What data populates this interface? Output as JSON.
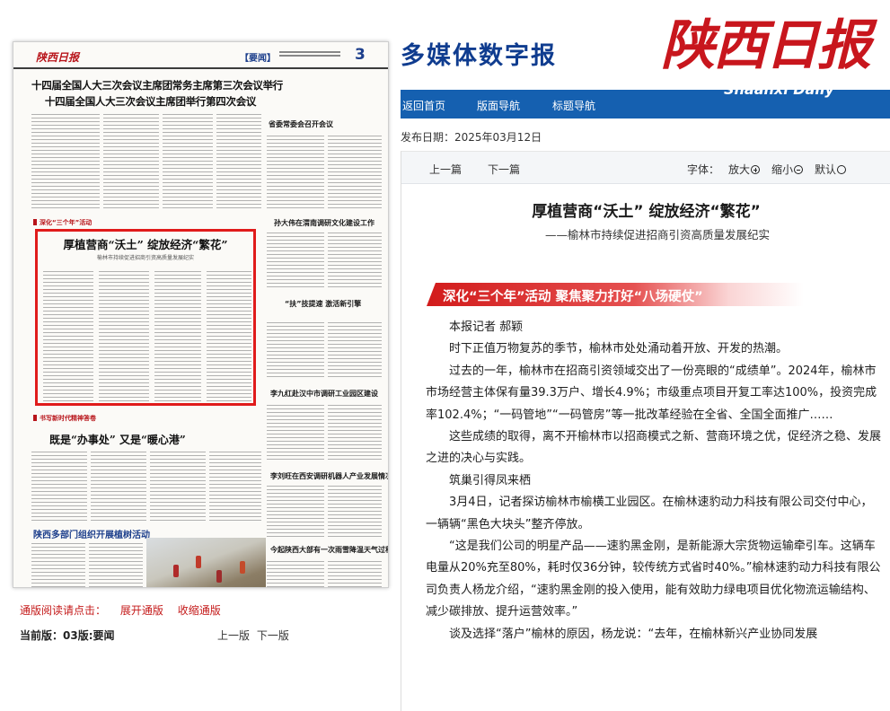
{
  "colors": {
    "brand_red": "#c8161d",
    "nav_blue": "#1560b0",
    "title_blue": "#0f3c8f",
    "highlight_red": "#e01b1b"
  },
  "thumbnail": {
    "logo": "陕西日报",
    "section": "【要闻】",
    "page_number": "3",
    "headline_1": "十四届全国人大三次会议主席团常务主席第三次会议举行",
    "headline_2": "十四届全国人大三次会议主席团举行第四次会议",
    "right_head_1": "省委常委会召开会议",
    "right_head_2": "孙大伟在渭南调研文化建设工作",
    "right_head_3": "“扶”技提速 激活新引擎",
    "right_head_4": "李九红赴汉中市调研工业园区建设",
    "right_head_5": "李刘旺在西安调研机器人产业发展情况",
    "right_head_6": "今起陕西大部有一次雨雪降温天气过程",
    "red_label_1": "深化“三个年”活动",
    "red_label_2": "书写新时代精神答卷",
    "box_title": "厚植营商“沃土” 绽放经济“繁花”",
    "box_subtitle": "榆林市持续促进招商引资高质量发展纪实",
    "article2_headline": "既是“办事处” 又是“暖心港”",
    "article3_headline": "陕西多部门组织开展植树活动"
  },
  "left_links": {
    "label": "通版阅读请点击：",
    "expand": "展开通版",
    "collapse": "收缩通版"
  },
  "current_page": "当前版：03版:要闻",
  "left_nav": {
    "prev": "上一版",
    "next": "下一版"
  },
  "banner": {
    "title": "多媒体数字报",
    "logo": "陕西日报",
    "english": "Shaanxi Daily"
  },
  "navbar": {
    "home": "返回首页",
    "page_nav": "版面导航",
    "title_nav": "标题导航"
  },
  "date": "发布日期：2025年03月12日",
  "toolbar": {
    "prev": "上一篇",
    "next": "下一篇",
    "font_label": "字体：",
    "bigger": "放大",
    "smaller": "缩小",
    "default": "默认"
  },
  "article": {
    "title": "厚植营商“沃土”  绽放经济“繁花”",
    "subtitle": "——榆林市持续促进招商引资高质量发展纪实",
    "section_heading": "深化“三个年”活动  聚焦聚力打好“八场硬仗”",
    "paragraphs": [
      "本报记者  郝颖",
      "时下正值万物复苏的季节，榆林市处处涌动着开放、开发的热潮。",
      "过去的一年，榆林市在招商引资领域交出了一份亮眼的“成绩单”。2024年，榆林市市场经营主体保有量39.3万户、增长4.9%；市级重点项目开复工率达100%，投资完成率102.4%；“一码管地”“一码管房”等一批改革经验在全省、全国全面推广……",
      "这些成绩的取得，离不开榆林市以招商模式之新、营商环境之优，促经济之稳、发展之进的决心与实践。",
      "筑巢引得凤来栖",
      "3月4日，记者探访榆林市榆横工业园区。在榆林速豹动力科技有限公司交付中心，一辆辆“黑色大块头”整齐停放。",
      "“这是我们公司的明星产品——速豹黑金刚，是新能源大宗货物运输牵引车。这辆车电量从20%充至80%，耗时仅36分钟，较传统方式省时40%。”榆林速豹动力科技有限公司负责人杨龙介绍，“速豹黑金刚的投入使用，能有效助力绿电项目优化物流运输结构、减少碳排放、提升运营效率。”",
      "谈及选择“落户”榆林的原因，杨龙说：“去年，在榆林新兴产业协同发展"
    ]
  }
}
